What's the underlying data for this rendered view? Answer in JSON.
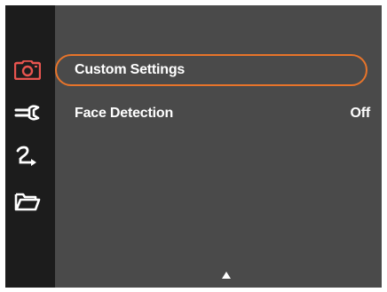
{
  "sidebar": {
    "icons": [
      {
        "name": "camera-icon",
        "active": true,
        "color": "#e8544f"
      },
      {
        "name": "wrench-icon",
        "active": false,
        "color": "#ffffff"
      },
      {
        "name": "transfer-icon",
        "active": false,
        "color": "#ffffff"
      },
      {
        "name": "folder-icon",
        "active": false,
        "color": "#ffffff"
      }
    ]
  },
  "menu": {
    "items": [
      {
        "label": "Custom Settings",
        "value": "",
        "selected": true
      },
      {
        "label": "Face Detection",
        "value": "Off",
        "selected": false
      }
    ]
  },
  "scroll": {
    "icon": "up-arrow-icon"
  },
  "colors": {
    "highlight": "#e8742a",
    "active_icon": "#e8544f",
    "panel": "#4a4a4a",
    "sidebar": "#1c1c1c"
  }
}
